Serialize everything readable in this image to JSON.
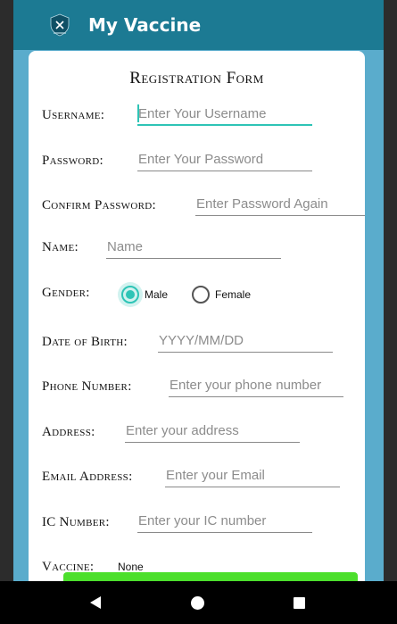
{
  "app": {
    "title": "My Vaccine"
  },
  "form": {
    "title": "Registration Form",
    "username": {
      "label": "Username:",
      "placeholder": "Enter Your Username"
    },
    "password": {
      "label": "Password:",
      "placeholder": "Enter Your Password"
    },
    "confirm_password": {
      "label": "Confirm Password:",
      "placeholder": "Enter Password Again"
    },
    "name": {
      "label": "Name:",
      "placeholder": "Name"
    },
    "gender": {
      "label": "Gender:",
      "options": [
        "Male",
        "Female"
      ],
      "selected": "Male"
    },
    "dob": {
      "label": "Date of Birth:",
      "placeholder": "YYYY/MM/DD"
    },
    "phone": {
      "label": "Phone Number:",
      "placeholder": "Enter your phone number"
    },
    "address": {
      "label": "Address:",
      "placeholder": "Enter your address"
    },
    "email": {
      "label": "Email Address:",
      "placeholder": "Enter your Email"
    },
    "ic": {
      "label": "IC Number:",
      "placeholder": "Enter your IC number"
    },
    "vaccine": {
      "label": "Vaccine:",
      "value": "None"
    }
  },
  "colors": {
    "appbar": "#1c7a93",
    "background": "#5aaccc",
    "accent": "#2ec4b6",
    "button": "#4cdf2c"
  },
  "navbar": {
    "icons": [
      "back-icon",
      "home-icon",
      "recents-icon"
    ]
  }
}
